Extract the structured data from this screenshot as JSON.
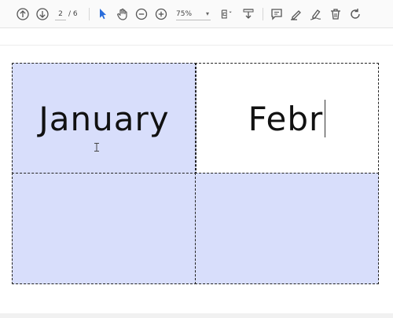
{
  "toolbar": {
    "page_current": "2",
    "page_total": "/ 6",
    "zoom": "75%",
    "zoom_caret": "▾",
    "icons": [
      "arrow-up-icon",
      "arrow-down-icon",
      "select-pointer-icon",
      "hand-tool-icon",
      "zoom-out-icon",
      "zoom-in-icon",
      "page-fit-icon",
      "download-icon",
      "comment-icon",
      "highlighter-icon",
      "pen-sign-icon",
      "trash-icon",
      "rotate-icon"
    ],
    "accent_color": "#2a6ddb"
  },
  "document": {
    "cells": [
      {
        "text": "January",
        "filled": true
      },
      {
        "text": "Febr",
        "filled": false
      },
      {
        "text": "",
        "filled": true
      },
      {
        "text": "",
        "filled": true
      }
    ],
    "fill_color": "#d8defb"
  }
}
